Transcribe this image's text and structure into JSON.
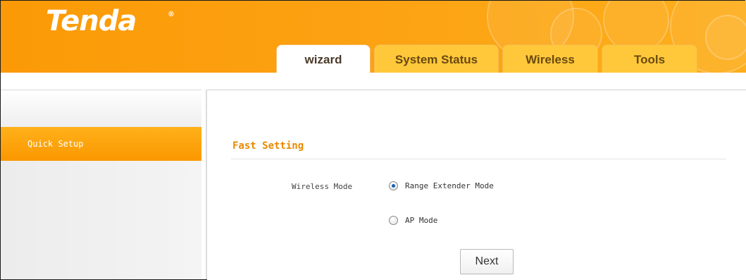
{
  "header": {
    "logo_text": "Tenda",
    "logo_mark": "®",
    "brand_color": "#fb9a06",
    "tabs": [
      {
        "label": "wizard",
        "active": true
      },
      {
        "label": "System Status",
        "active": false
      },
      {
        "label": "Wireless",
        "active": false
      },
      {
        "label": "Tools",
        "active": false
      }
    ]
  },
  "sidebar": {
    "items": [
      {
        "label": "Quick Setup",
        "active": true
      }
    ]
  },
  "main": {
    "section_title": "Fast Setting",
    "field_label": "Wireless Mode",
    "options": [
      {
        "label": "Range Extender Mode",
        "checked": true
      },
      {
        "label": "AP Mode",
        "checked": false
      }
    ],
    "next_label": "Next"
  }
}
